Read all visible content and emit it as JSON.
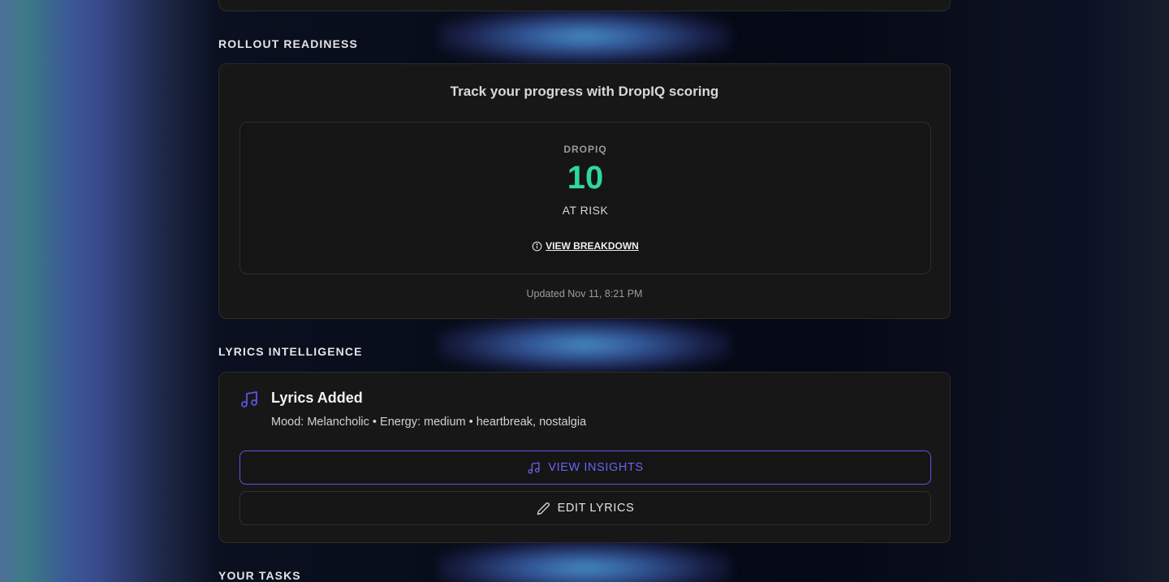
{
  "colors": {
    "accent_green": "#2fd89c",
    "accent_indigo": "#5a55e6",
    "card_bg": "#171717"
  },
  "sections": {
    "rollout": {
      "label": "ROLLOUT READINESS",
      "title": "Track your progress with DropIQ scoring",
      "score_caption": "DROPIQ",
      "score_value": "10",
      "score_status": "AT RISK",
      "breakdown_icon": "info-icon",
      "breakdown_label": "VIEW BREAKDOWN",
      "updated_text": "Updated Nov 11, 8:21 PM"
    },
    "lyrics": {
      "label": "LYRICS INTELLIGENCE",
      "icon": "music-note-icon",
      "title": "Lyrics Added",
      "meta": "Mood: Melancholic • Energy: medium • heartbreak, nostalgia",
      "insights_button": {
        "label": "VIEW INSIGHTS",
        "icon": "music-note-icon"
      },
      "edit_button": {
        "label": "EDIT LYRICS",
        "icon": "pencil-icon"
      }
    },
    "tasks": {
      "label": "YOUR TASKS"
    }
  }
}
